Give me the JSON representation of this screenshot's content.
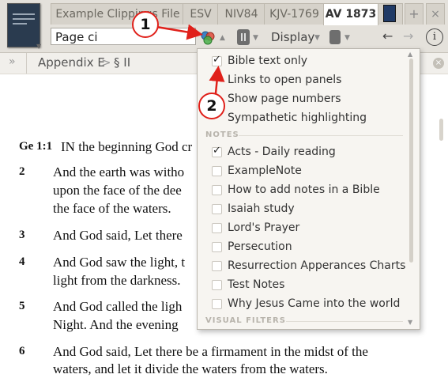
{
  "tabs": [
    {
      "label": "Example Clippings File",
      "active": false
    },
    {
      "label": "ESV",
      "active": false
    },
    {
      "label": "NIV84",
      "active": false
    },
    {
      "label": "KJV-1769",
      "active": false
    },
    {
      "label": "AV 1873",
      "active": true
    }
  ],
  "tab_add": "+",
  "tab_close": "×",
  "toolbar": {
    "search_value": "Page ci",
    "display_label": "Display",
    "back": "←",
    "forward": "→",
    "info": "i"
  },
  "breadcrumb": {
    "chevron": "»",
    "part1": "Appendix E",
    "sep": ">",
    "part2": "§ II",
    "close": "×"
  },
  "verses": [
    {
      "num": "Ge 1:1",
      "text": "IN the beginning God cr"
    },
    {
      "num": "2",
      "lines": [
        "And the earth was witho",
        "upon the face of the dee",
        "the face of the waters."
      ]
    },
    {
      "num": "3",
      "lines": [
        "And God said, Let there"
      ]
    },
    {
      "num": "4",
      "lines": [
        "And God saw the light, t",
        "light from the darkness."
      ]
    },
    {
      "num": "5",
      "lines": [
        "And God called the ligh",
        "Night. And the evening"
      ]
    },
    {
      "num": "6",
      "lines": [
        "And God said, Let there be a firmament in the midst of the",
        "waters, and let it divide the waters from the waters."
      ]
    }
  ],
  "menu": {
    "display_items": [
      {
        "label": "Bible text only",
        "checked": true
      },
      {
        "label": "Links to open panels",
        "checked": false
      },
      {
        "label": "Show page numbers",
        "checked": false
      },
      {
        "label": "Sympathetic highlighting",
        "checked": false
      }
    ],
    "notes_header": "NOTES",
    "notes_items": [
      {
        "label": "Acts - Daily reading",
        "checked": true
      },
      {
        "label": "ExampleNote",
        "checked": false
      },
      {
        "label": "How to add notes in a Bible",
        "checked": false
      },
      {
        "label": "Isaiah study",
        "checked": false
      },
      {
        "label": "Lord's Prayer",
        "checked": false
      },
      {
        "label": "Persecution",
        "checked": false
      },
      {
        "label": "Resurrection Apperances Charts",
        "checked": false
      },
      {
        "label": "Test Notes",
        "checked": false
      },
      {
        "label": "Why Jesus Came into the world",
        "checked": false
      }
    ],
    "visual_filters_header": "VISUAL FILTERS"
  },
  "annotations": {
    "callout1": "1",
    "callout2": "2",
    "color": "#e0201a"
  }
}
